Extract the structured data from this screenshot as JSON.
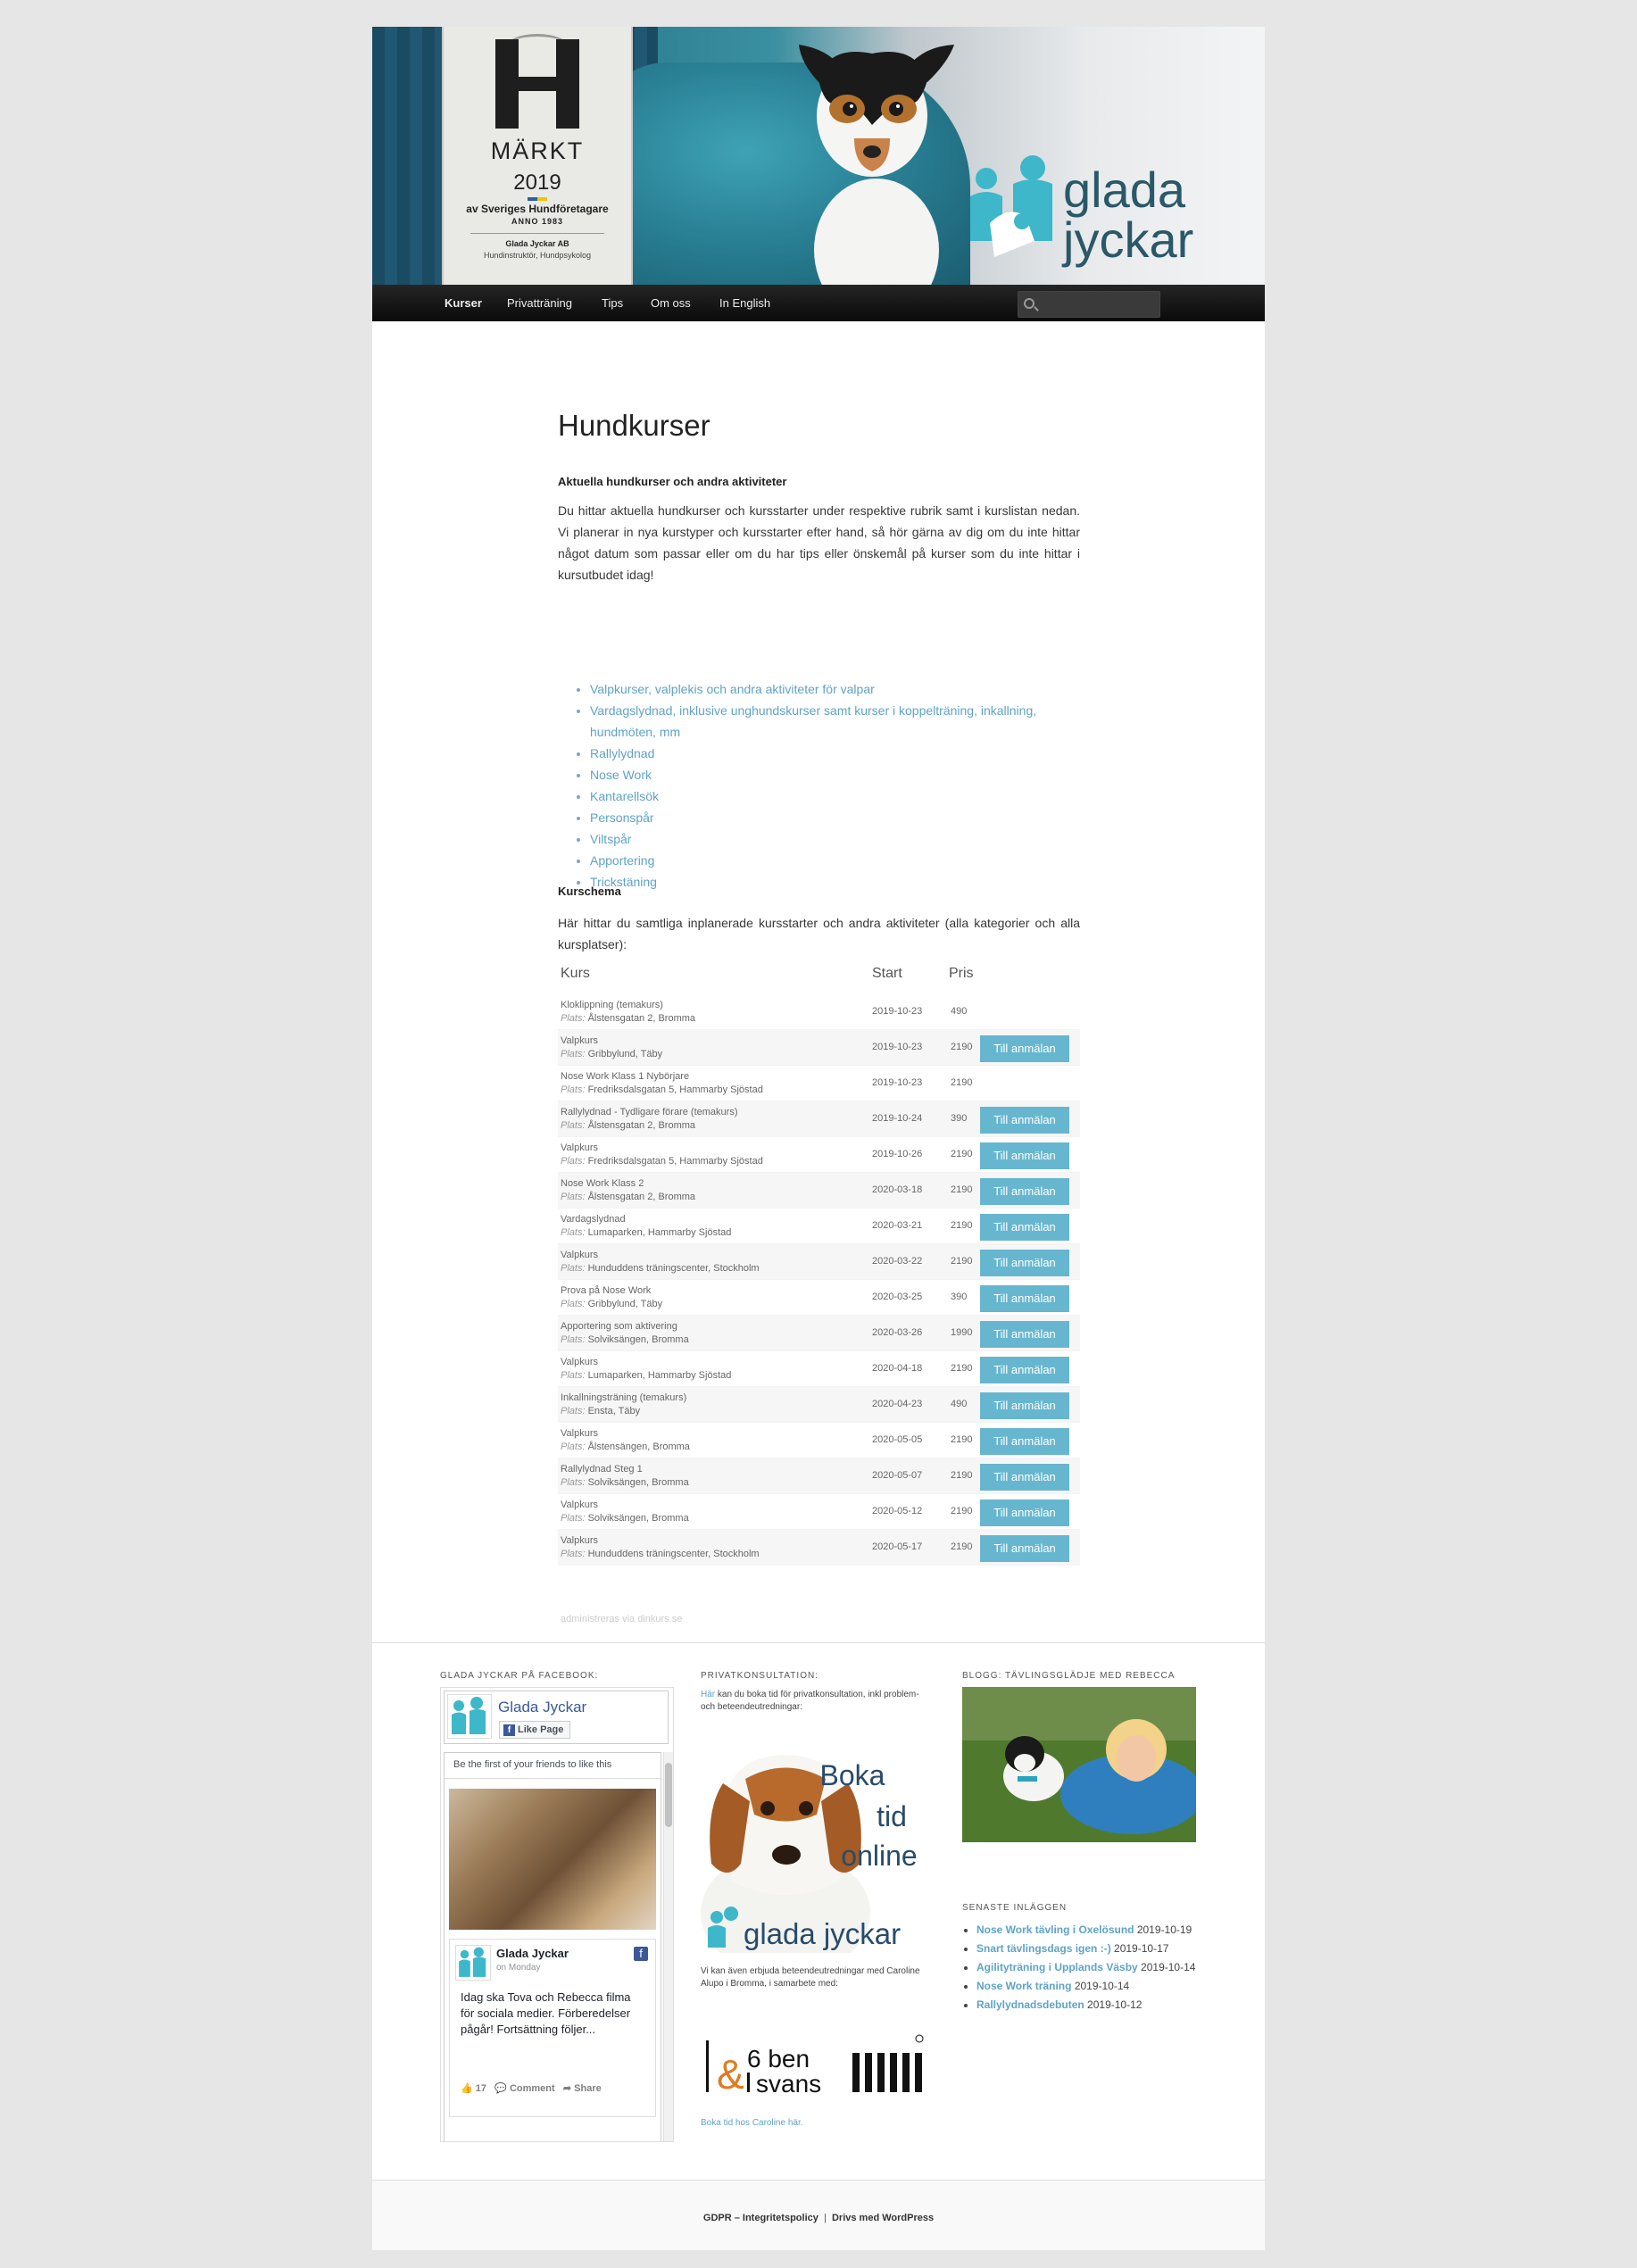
{
  "badge": {
    "letter": "H",
    "markt": "MÄRKT",
    "year": "2019",
    "org": "av Sveriges Hundföretagare",
    "anno": "ANNO 1983",
    "company": "Glada Jyckar AB",
    "subtitle": "Hundinstruktör, Hundpsykolog"
  },
  "logo": {
    "line1": "glada",
    "line2": "jyckar",
    "color": "#2a5868",
    "accent": "#3db7c9"
  },
  "nav": {
    "items": [
      {
        "label": "Kurser",
        "active": true
      },
      {
        "label": "Privatträning",
        "active": false
      },
      {
        "label": "Tips",
        "active": false
      },
      {
        "label": "Om oss",
        "active": false
      },
      {
        "label": "In English",
        "active": false
      }
    ],
    "search_placeholder": "Sök"
  },
  "page": {
    "title": "Hundkurser",
    "section1_heading": "Aktuella hundkurser och andra aktiviteter",
    "intro": "Du hittar aktuella hundkurser och kursstarter under respektive rubrik samt i kurslistan nedan. Vi planerar in nya kurstyper och kursstarter efter hand, så hör gärna av dig om du inte hittar något datum som passar eller om du har tips eller önskemål på kurser som du inte hittar i kursutbudet idag!",
    "categories": [
      "Valpkurser, valplekis och andra aktiviteter för valpar",
      "Vardagslydnad, inklusive unghundskurser samt kurser i koppelträning, inkallning, hundmöten, mm",
      "Rallylydnad",
      "Nose Work",
      "Kantarellsök",
      "Personspår",
      "Viltspår",
      "Apportering",
      "Trickstäning"
    ],
    "schedule_heading": "Kurschema",
    "schedule_intro": "Här hittar du samtliga inplanerade kursstarter och andra aktiviteter (alla kategorier och alla kursplatser):"
  },
  "table": {
    "headers": {
      "course": "Kurs",
      "start": "Start",
      "price": "Pris"
    },
    "place_label": "Plats:",
    "button_label": "Till anmälan",
    "rows": [
      {
        "course": "Kloklippning (temakurs)",
        "place": "Ålstensgatan 2, Bromma",
        "start": "2019-10-23",
        "price": "490",
        "button": false
      },
      {
        "course": "Valpkurs",
        "place": "Gribbylund, Täby",
        "start": "2019-10-23",
        "price": "2190",
        "button": true
      },
      {
        "course": "Nose Work Klass 1 Nybörjare",
        "place": "Fredriksdalsgatan 5, Hammarby Sjöstad",
        "start": "2019-10-23",
        "price": "2190",
        "button": false
      },
      {
        "course": "Rallylydnad - Tydligare förare (temakurs)",
        "place": "Ålstensgatan 2, Bromma",
        "start": "2019-10-24",
        "price": "390",
        "button": true
      },
      {
        "course": "Valpkurs",
        "place": "Fredriksdalsgatan 5, Hammarby Sjöstad",
        "start": "2019-10-26",
        "price": "2190",
        "button": true
      },
      {
        "course": "Nose Work Klass 2",
        "place": "Ålstensgatan 2, Bromma",
        "start": "2020-03-18",
        "price": "2190",
        "button": true
      },
      {
        "course": "Vardagslydnad",
        "place": "Lumaparken, Hammarby Sjöstad",
        "start": "2020-03-21",
        "price": "2190",
        "button": true
      },
      {
        "course": "Valpkurs",
        "place": "Hunduddens träningscenter, Stockholm",
        "start": "2020-03-22",
        "price": "2190",
        "button": true
      },
      {
        "course": "Prova på Nose Work",
        "place": "Gribbylund, Täby",
        "start": "2020-03-25",
        "price": "390",
        "button": true
      },
      {
        "course": "Apportering som aktivering",
        "place": "Solviksängen, Bromma",
        "start": "2020-03-26",
        "price": "1990",
        "button": true
      },
      {
        "course": "Valpkurs",
        "place": "Lumaparken, Hammarby Sjöstad",
        "start": "2020-04-18",
        "price": "2190",
        "button": true
      },
      {
        "course": "Inkallningsträning (temakurs)",
        "place": "Ensta, Täby",
        "start": "2020-04-23",
        "price": "490",
        "button": true
      },
      {
        "course": "Valpkurs",
        "place": "Ålstensängen, Bromma",
        "start": "2020-05-05",
        "price": "2190",
        "button": true
      },
      {
        "course": "Rallylydnad Steg 1",
        "place": "Solviksängen, Bromma",
        "start": "2020-05-07",
        "price": "2190",
        "button": true
      },
      {
        "course": "Valpkurs",
        "place": "Solviksängen, Bromma",
        "start": "2020-05-12",
        "price": "2190",
        "button": true
      },
      {
        "course": "Valpkurs",
        "place": "Hunduddens träningscenter, Stockholm",
        "start": "2020-05-17",
        "price": "2190",
        "button": true
      }
    ],
    "admin_note": "administreras via dinkurs.se"
  },
  "widgets": {
    "facebook": {
      "title": "Glada Jyckar på Facebook:",
      "page_name": "Glada Jyckar",
      "like_label": "Like Page",
      "first_friends": "Be the first of your friends to like this",
      "post_author": "Glada Jyckar",
      "post_date": "on Monday",
      "post_text": "Idag ska Tova och Rebecca filma för sociala medier. Förberedelser pågår! Fortsättning följer...",
      "likes": "17",
      "comment_label": "Comment",
      "share_label": "Share"
    },
    "private": {
      "title": "Privatkonsultation:",
      "link_word": "Här",
      "text": "kan du boka tid för privatkonsultation, inkl problem- och beteendeutredningar:",
      "boka": [
        "Boka",
        "tid",
        "online"
      ],
      "logo_text": "glada jyckar",
      "partner_text": "Vi kan även erbjuda beteendeutredningar med Caroline Alupo i Bromma, i samarbete med:",
      "partner_brand_1": "6 ben",
      "partner_brand_2": "svans",
      "partner_amp": "&",
      "partner_link": "Boka tid hos Caroline här."
    },
    "blog": {
      "title": "Blogg: Tävlingsglädje med Rebecca",
      "recent_title": "Senaste inläggen",
      "posts": [
        {
          "title": "Nose Work tävling i Oxelösund",
          "date": "2019-10-19"
        },
        {
          "title": "Snart tävlingsdags igen :-)",
          "date": "2019-10-17"
        },
        {
          "title": "Agilityträning i Upplands Väsby",
          "date": "2019-10-14"
        },
        {
          "title": "Nose Work träning",
          "date": "2019-10-14"
        },
        {
          "title": "Rallylydnadsdebuten",
          "date": "2019-10-12"
        }
      ]
    }
  },
  "footer": {
    "gdpr": "GDPR – Integritetspolicy",
    "sep": "|",
    "powered": "Drivs med WordPress"
  }
}
